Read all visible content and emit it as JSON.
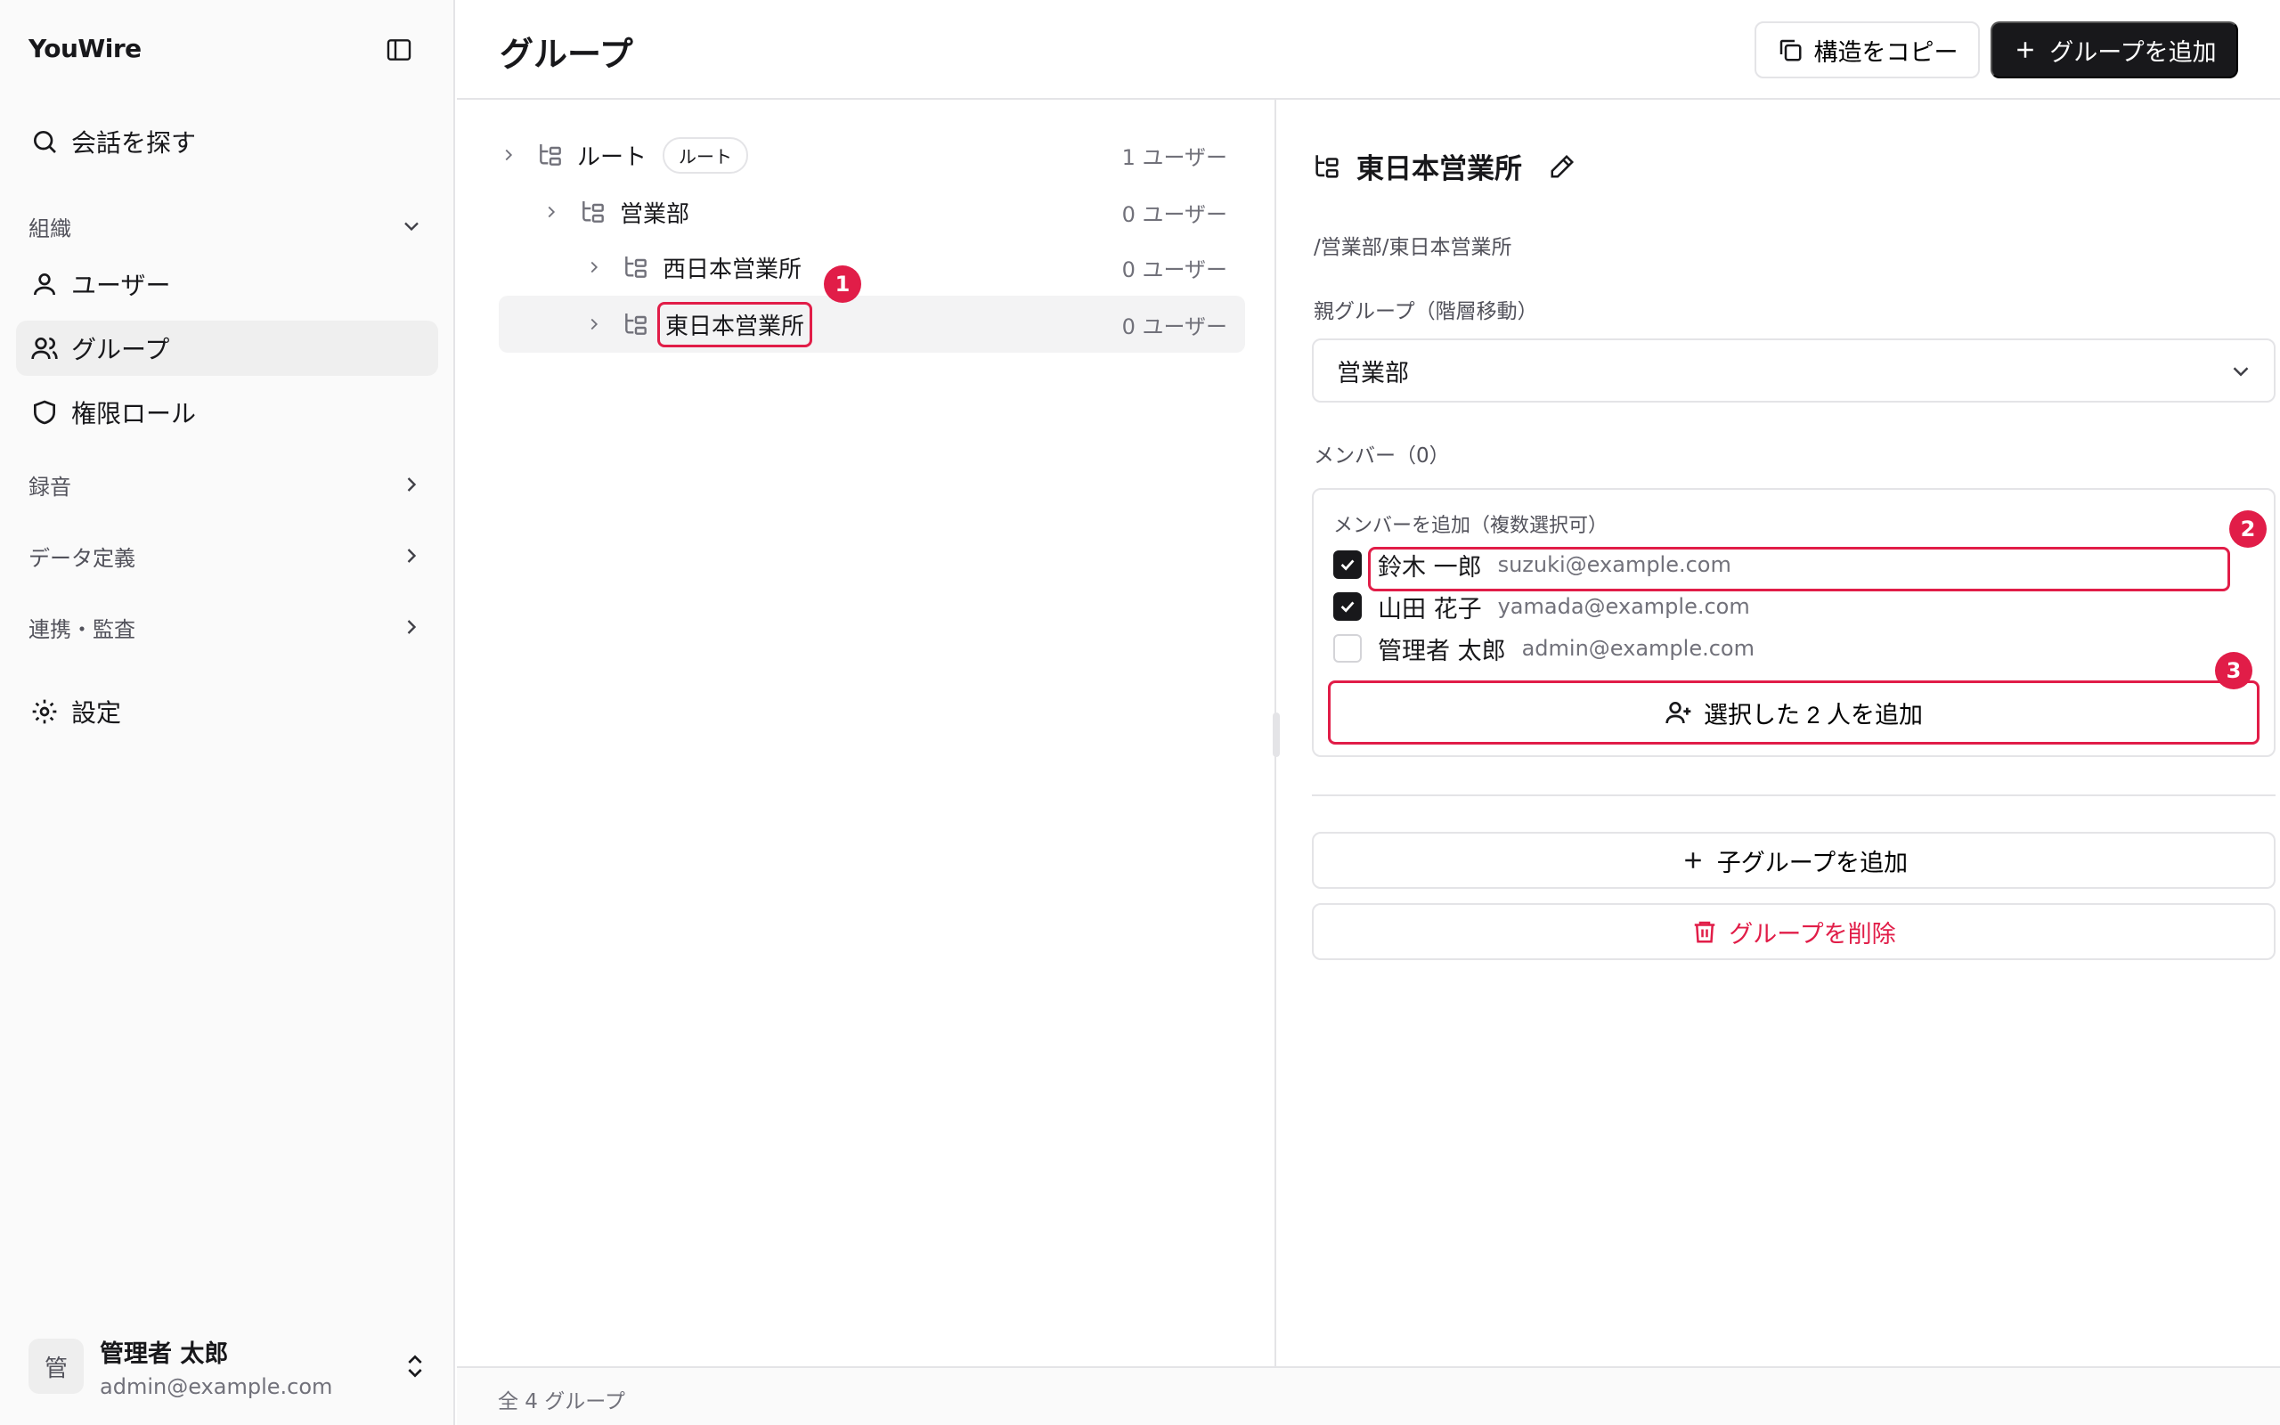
{
  "app": {
    "brand": "YouWire"
  },
  "sidebar": {
    "search_label": "会話を探す",
    "org_section": "組織",
    "items": [
      {
        "label": "ユーザー",
        "icon": "user-icon"
      },
      {
        "label": "グループ",
        "icon": "users-icon"
      },
      {
        "label": "権限ロール",
        "icon": "shield-icon"
      }
    ],
    "sections": [
      {
        "label": "録音"
      },
      {
        "label": "データ定義"
      },
      {
        "label": "連携・監査"
      }
    ],
    "settings_label": "設定",
    "user": {
      "avatar": "管",
      "name": "管理者 太郎",
      "email": "admin@example.com"
    }
  },
  "header": {
    "title": "グループ",
    "copy_button": "構造をコピー",
    "add_button": "グループを追加"
  },
  "tree": {
    "rows": [
      {
        "name": "ルート",
        "badge": "ルート",
        "count": "1 ユーザー"
      },
      {
        "name": "営業部",
        "count": "0 ユーザー"
      },
      {
        "name": "西日本営業所",
        "count": "0 ユーザー"
      },
      {
        "name": "東日本営業所",
        "count": "0 ユーザー"
      }
    ]
  },
  "markers": [
    "1",
    "2",
    "3"
  ],
  "detail": {
    "title": "東日本営業所",
    "path": "/営業部/東日本営業所",
    "parent_label": "親グループ（階層移動）",
    "parent_value": "営業部",
    "members_label": "メンバー（0）",
    "add_members_label": "メンバーを追加（複数選択可）",
    "candidates": [
      {
        "name": "鈴木 一郎",
        "email": "suzuki@example.com",
        "checked": true
      },
      {
        "name": "山田 花子",
        "email": "yamada@example.com",
        "checked": true
      },
      {
        "name": "管理者 太郎",
        "email": "admin@example.com",
        "checked": false
      }
    ],
    "add_selected_button": "選択した 2 人を追加",
    "add_child_button": "子グループを追加",
    "delete_button": "グループを削除"
  },
  "footer": {
    "total": "全 4 グループ"
  },
  "colors": {
    "accent": "#e11d48",
    "primary": "#18181b",
    "border": "#e4e4e7"
  }
}
